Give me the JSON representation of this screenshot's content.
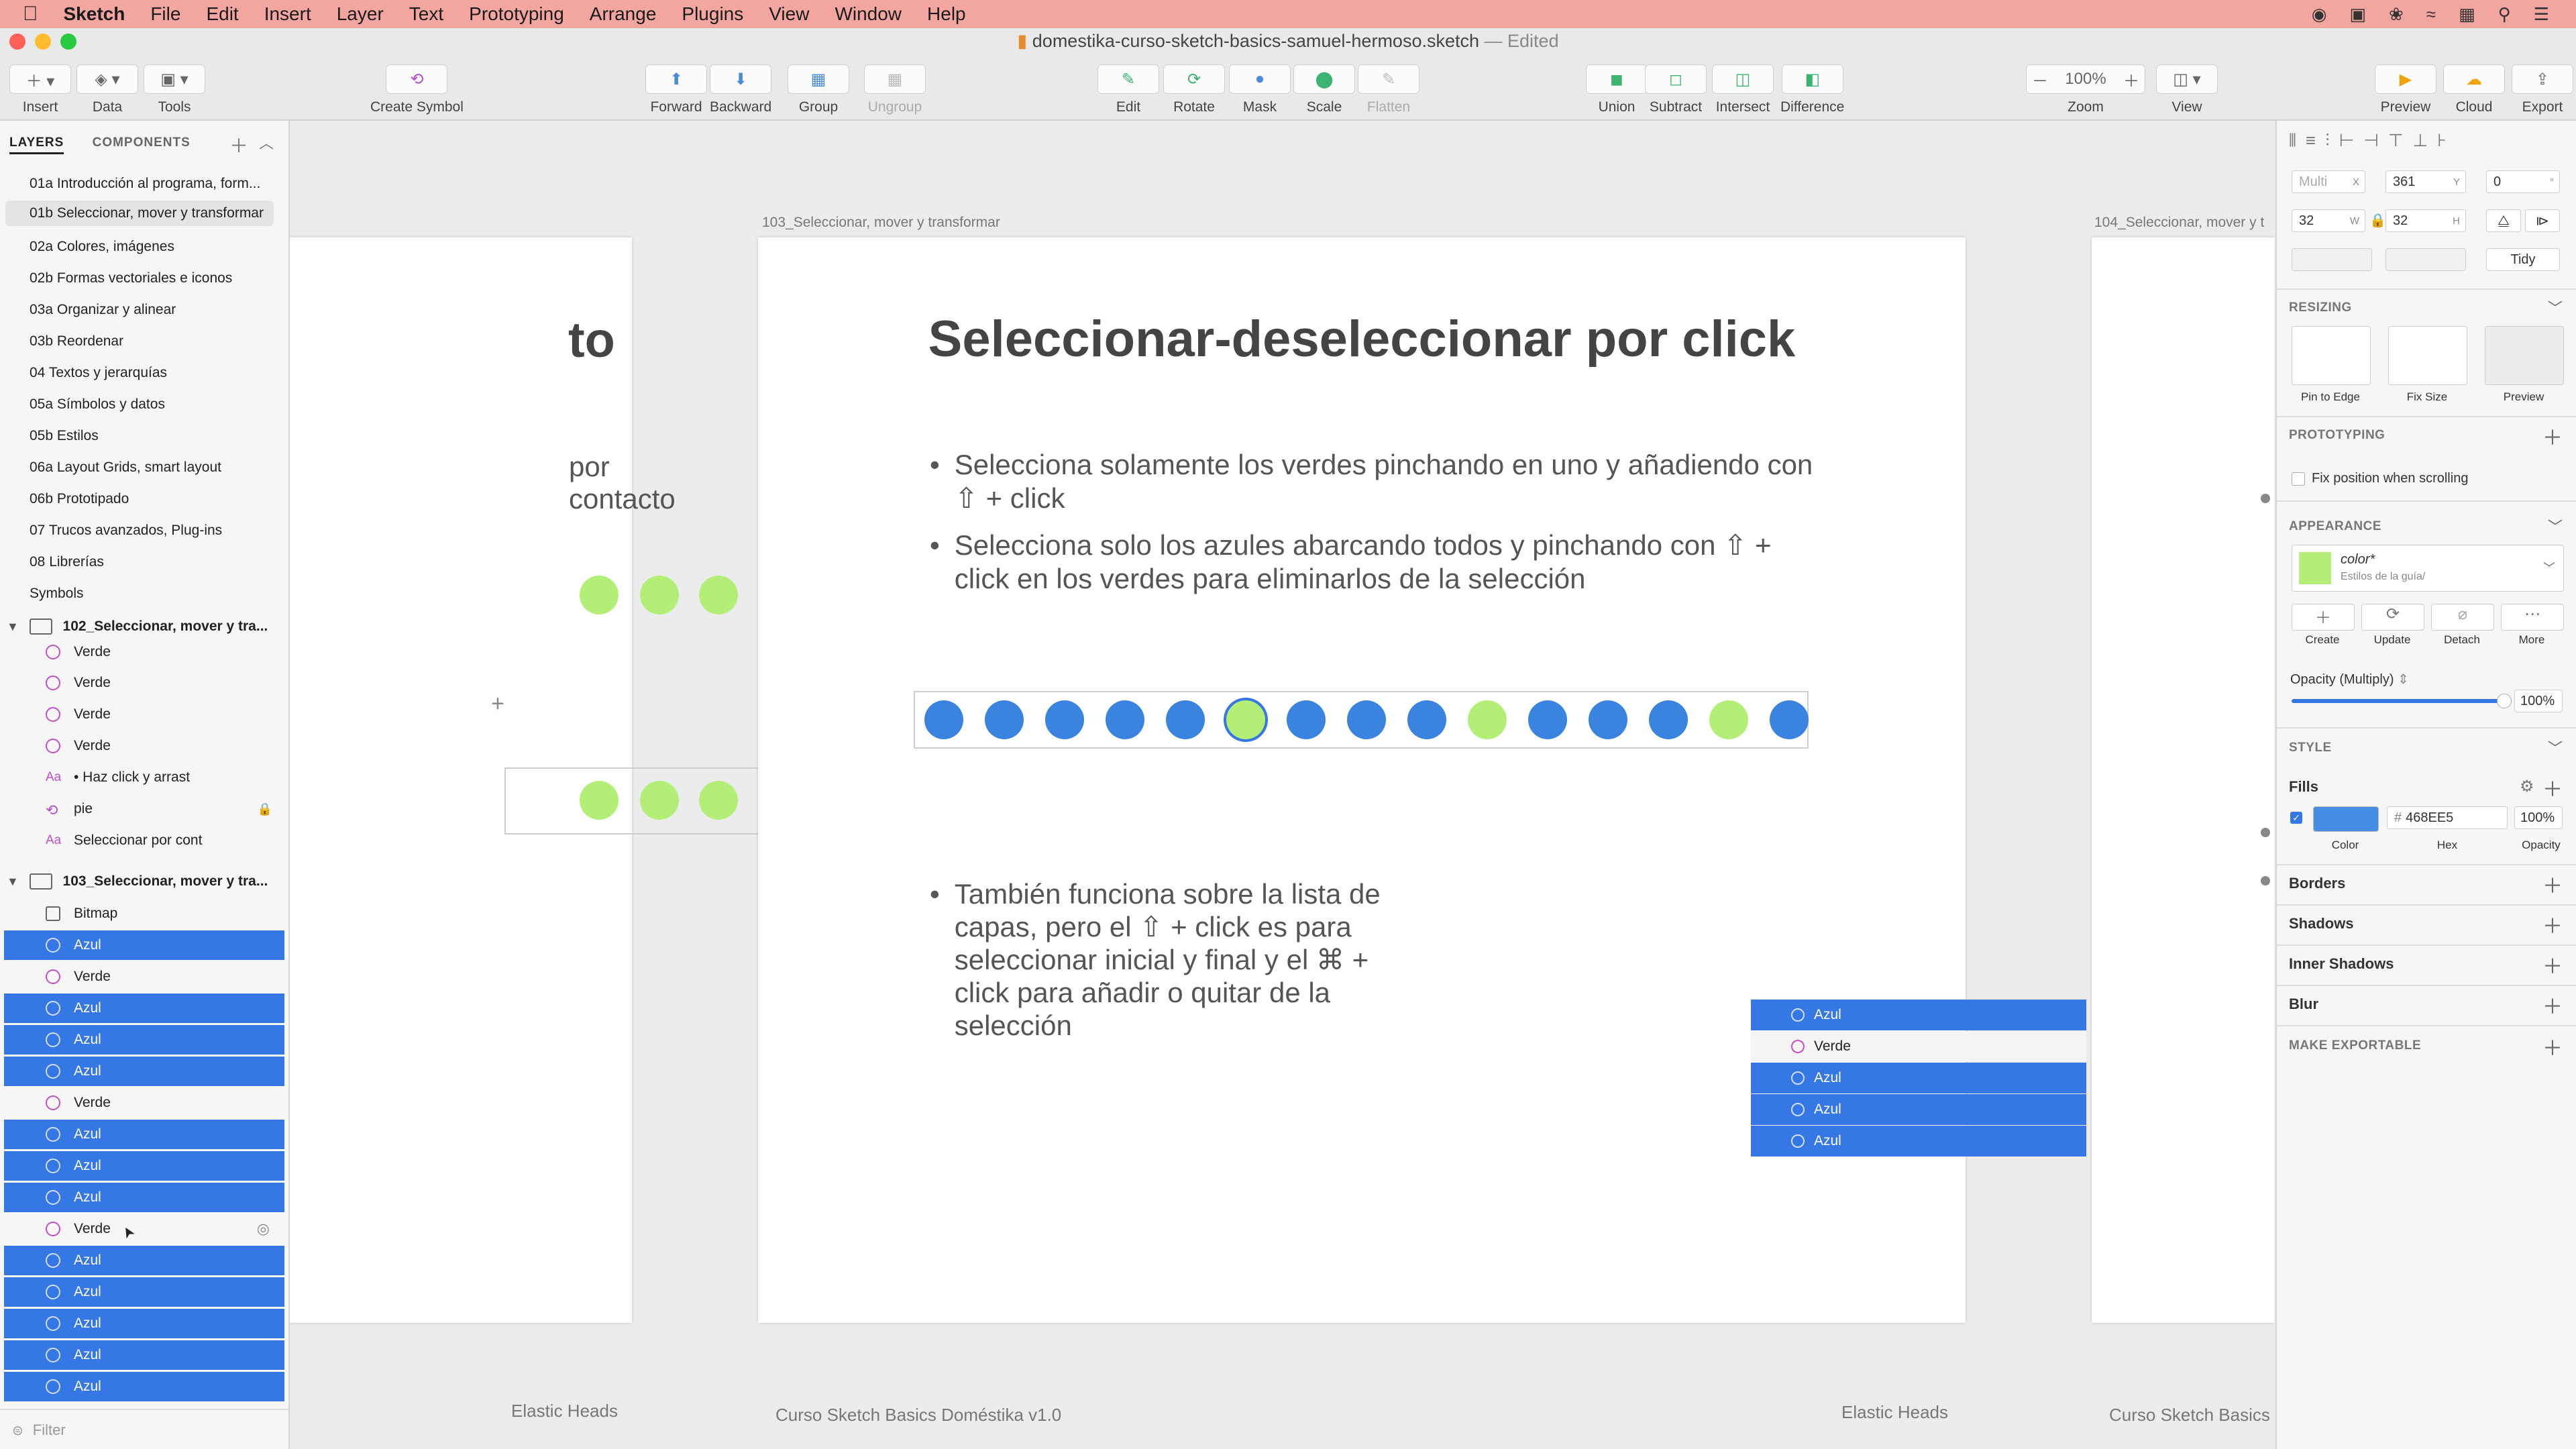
{
  "menubar": {
    "app": "Sketch",
    "items": [
      "File",
      "Edit",
      "Insert",
      "Layer",
      "Text",
      "Prototyping",
      "Arrange",
      "Plugins",
      "View",
      "Window",
      "Help"
    ]
  },
  "window": {
    "title": "domestika-curso-sketch-basics-samuel-hermoso.sketch",
    "edited": "— Edited"
  },
  "toolbar": {
    "insert": "Insert",
    "data": "Data",
    "tools": "Tools",
    "create_symbol": "Create Symbol",
    "forward": "Forward",
    "backward": "Backward",
    "group": "Group",
    "ungroup": "Ungroup",
    "edit": "Edit",
    "rotate": "Rotate",
    "mask": "Mask",
    "scale": "Scale",
    "flatten": "Flatten",
    "union": "Union",
    "subtract": "Subtract",
    "intersect": "Intersect",
    "difference": "Difference",
    "zoom_label": "Zoom",
    "zoom_value": "100%",
    "view": "View",
    "preview": "Preview",
    "cloud": "Cloud",
    "export": "Export"
  },
  "left_panel": {
    "tab_layers": "LAYERS",
    "tab_components": "COMPONENTS",
    "pages": [
      "01a Introducción al programa, form...",
      "01b Seleccionar, mover y transformar",
      "02a Colores, imágenes",
      "02b Formas vectoriales e iconos",
      "03a Organizar y alinear",
      "03b Reordenar",
      "04 Textos y jerarquías",
      "05a Símbolos y datos",
      "05b Estilos",
      "06a Layout Grids, smart layout",
      "06b Prototipado",
      "07 Trucos avanzados, Plug-ins",
      "08 Librerías",
      "Symbols"
    ],
    "artboard_102": "102_Seleccionar, mover y tra...",
    "layers_102": [
      "Verde",
      "Verde",
      "Verde",
      "Verde",
      "• Haz click y arrast",
      "pie",
      "Seleccionar por cont"
    ],
    "artboard_103": "103_Seleccionar, mover y tra...",
    "layers_103": [
      "Bitmap",
      "Azul",
      "Verde",
      "Azul",
      "Azul",
      "Azul",
      "Verde",
      "Azul",
      "Azul",
      "Azul",
      "Verde",
      "Azul",
      "Azul",
      "Azul",
      "Azul",
      "Azul"
    ],
    "filter": "Filter"
  },
  "canvas": {
    "board_left_title_fragment": "to",
    "board_left_bullet_fragment": "por contacto",
    "board_left_footer": "Elastic Heads",
    "board_main_name": "103_Seleccionar, mover y transformar",
    "title": "Seleccionar-deseleccionar por click",
    "bullet1": "Selecciona solamente los verdes pinchando en uno y añadiendo con ⇧ + click",
    "bullet2": "Selecciona solo los azules abarcando todos y pinchando con ⇧ + click en los verdes para eliminarlos de la selección",
    "bullet3": "También funciona sobre la lista de capas, pero el ⇧ + click es para seleccionar inicial y final y el ⌘ + click para añadir o quitar de la selección",
    "mini_list": [
      "Azul",
      "Verde",
      "Azul",
      "Azul",
      "Azul"
    ],
    "footer_left": "Curso Sketch Basics Doméstika v1.0",
    "footer_right": "Elastic Heads",
    "board_right_name": "104_Seleccionar, mover y t",
    "board_right_footer": "Curso Sketch Basics",
    "dots": [
      "blue",
      "blue",
      "blue",
      "blue",
      "blue",
      "green",
      "blue",
      "blue",
      "blue",
      "green",
      "blue",
      "blue",
      "blue",
      "green",
      "blue"
    ]
  },
  "right_panel": {
    "x_value": "Multi",
    "x_unit": "X",
    "y_value": "361",
    "y_unit": "Y",
    "rot_value": "0",
    "rot_unit": "°",
    "w_value": "32",
    "w_unit": "W",
    "h_value": "32",
    "h_unit": "H",
    "tidy": "Tidy",
    "resizing": "RESIZING",
    "pin_to_edge": "Pin to Edge",
    "fix_size": "Fix Size",
    "preview": "Preview",
    "prototyping": "PROTOTYPING",
    "fix_position": "Fix position when scrolling",
    "appearance": "APPEARANCE",
    "style_name": "color*",
    "style_sub": "Estilos de la guía/",
    "create": "Create",
    "update": "Update",
    "detach": "Detach",
    "more": "More",
    "opacity_label": "Opacity (Multiply)",
    "opacity_value": "100%",
    "style": "STYLE",
    "fills": "Fills",
    "hex": "468EE5",
    "fill_opacity": "100%",
    "color_lbl": "Color",
    "hex_lbl": "Hex",
    "opacity_lbl": "Opacity",
    "borders": "Borders",
    "shadows": "Shadows",
    "inner_shadows": "Inner Shadows",
    "blur": "Blur",
    "make_exportable": "MAKE EXPORTABLE"
  },
  "colors": {
    "accent": "#3677e6",
    "blue_fill": "#468EE5",
    "green_fill": "#b3ef76",
    "menubar": "#f3a6a0",
    "verde_icon": "#c250c8",
    "brand_logo": "#c0142c"
  }
}
